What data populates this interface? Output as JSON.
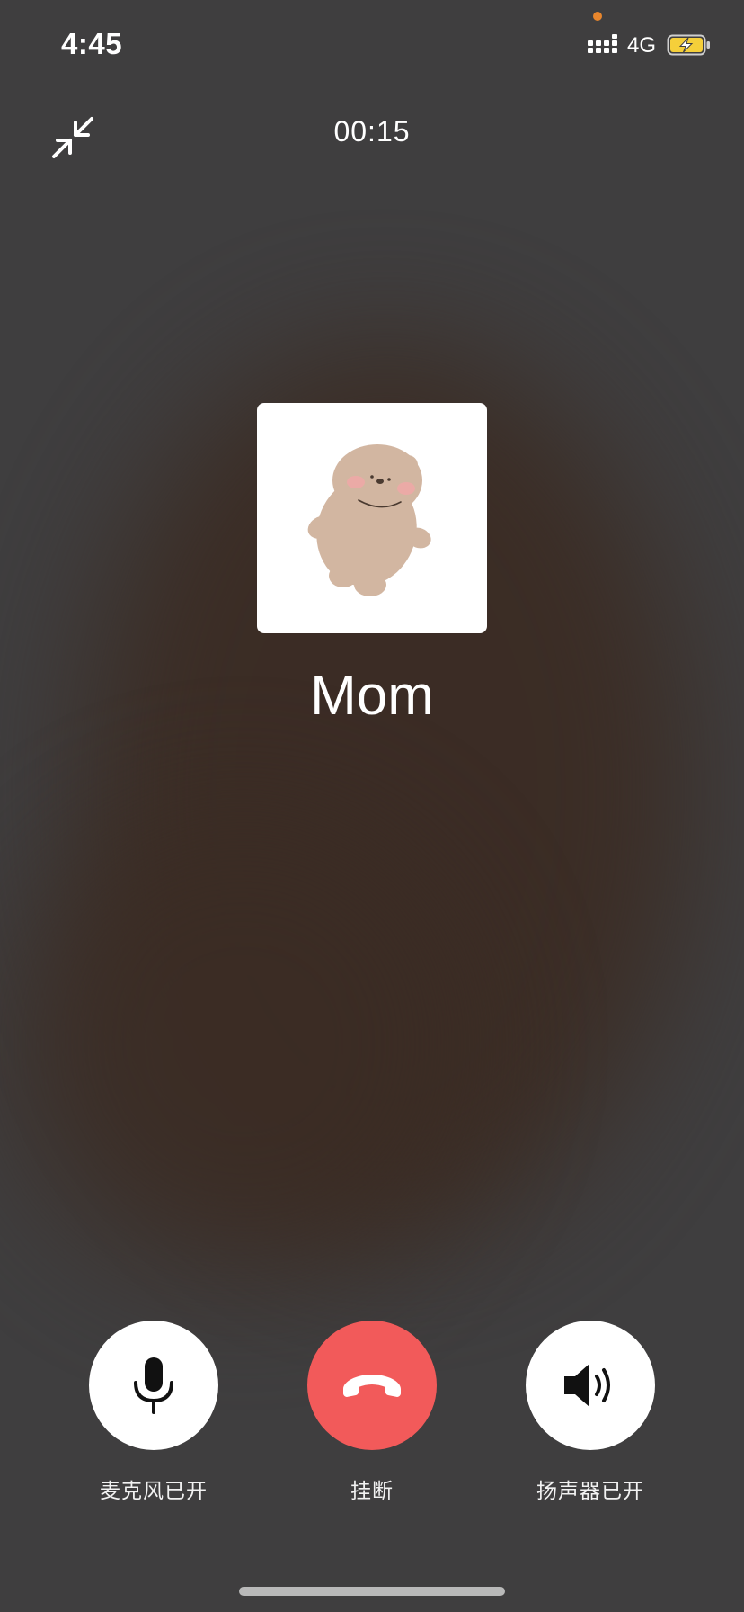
{
  "status_bar": {
    "time": "4:45",
    "network": "4G",
    "privacy_dot_color": "#e8862d",
    "battery_color": "#f5cf3a"
  },
  "call": {
    "timer": "00:15",
    "contact_name": "Mom",
    "avatar_icon": "bear-avatar-icon"
  },
  "controls": {
    "microphone": {
      "label": "麦克风已开",
      "icon": "microphone-icon"
    },
    "hangup": {
      "label": "挂断",
      "icon": "phone-hangup-icon",
      "color": "#f25a5a"
    },
    "speaker": {
      "label": "扬声器已开",
      "icon": "speaker-icon"
    }
  },
  "theme": {
    "background": "#3f3e3f",
    "blur_tint": "#3b2c24",
    "button_light": "#ffffff",
    "home_indicator": "#b9b9b9"
  }
}
